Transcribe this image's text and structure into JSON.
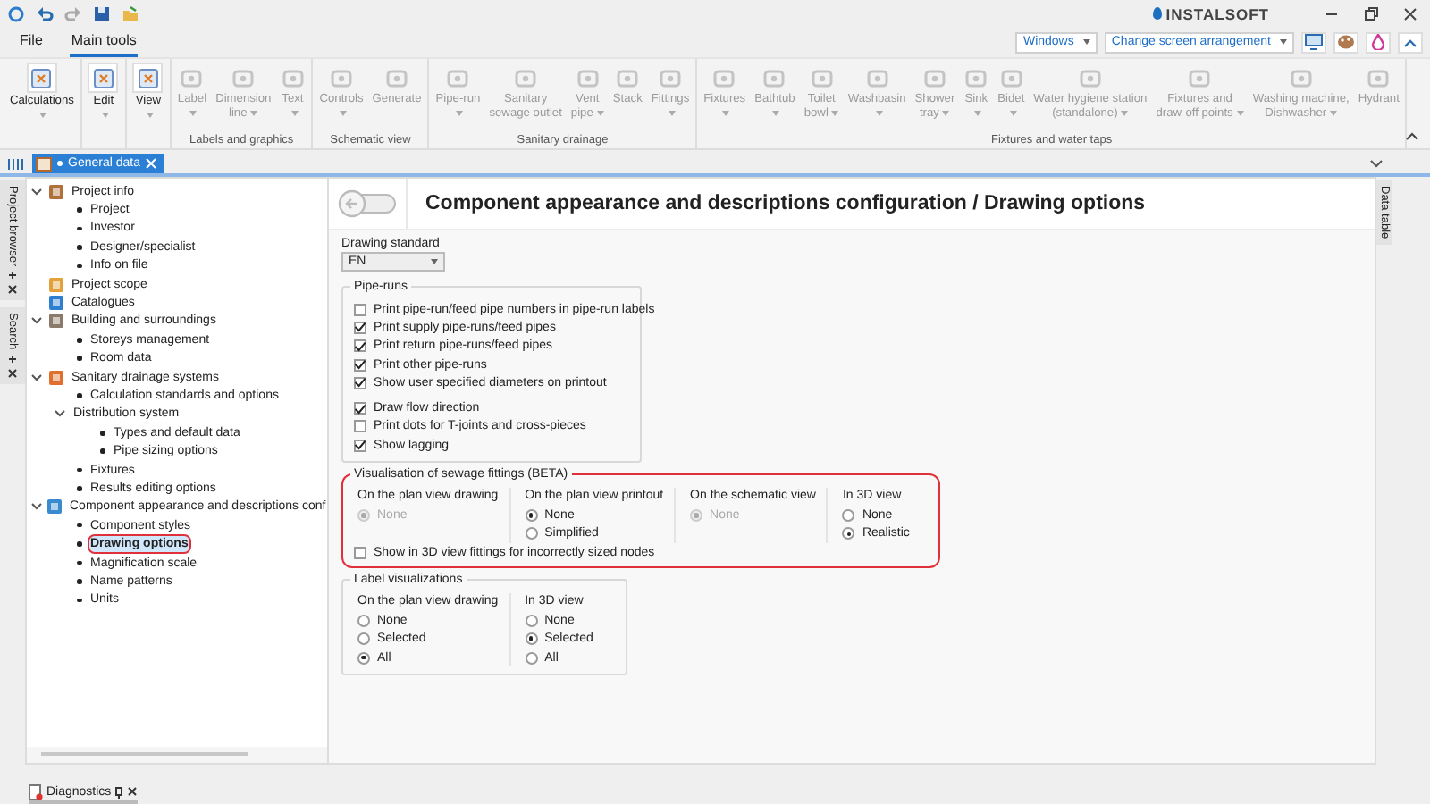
{
  "menu_tabs": [
    {
      "label": "File",
      "selected": false
    },
    {
      "label": "Main tools",
      "selected": true
    }
  ],
  "logo": {
    "text": "INSTALSOFT"
  },
  "window_dropdowns": [
    {
      "label": "Windows"
    },
    {
      "label": "Change screen arrangement"
    }
  ],
  "ribbon": {
    "groups": [
      {
        "items": [
          {
            "lines": [
              "Calculations"
            ],
            "disabled": false,
            "dropdown": true
          }
        ]
      },
      {
        "items": [
          {
            "lines": [
              "Edit"
            ],
            "disabled": false,
            "dropdown": true
          }
        ]
      },
      {
        "items": [
          {
            "lines": [
              "View"
            ],
            "disabled": false,
            "dropdown": true
          }
        ]
      },
      {
        "label": "Labels and graphics",
        "items": [
          {
            "lines": [
              "Label"
            ],
            "disabled": true,
            "dropdown": true
          },
          {
            "lines": [
              "Dimension",
              "line"
            ],
            "disabled": true,
            "dropdown": true
          },
          {
            "lines": [
              "Text"
            ],
            "disabled": true,
            "dropdown": true
          }
        ]
      },
      {
        "label": "Schematic view",
        "items": [
          {
            "lines": [
              "Controls"
            ],
            "disabled": true,
            "dropdown": true
          },
          {
            "lines": [
              "Generate"
            ],
            "disabled": true,
            "dropdown": false
          }
        ]
      },
      {
        "label": "Sanitary drainage",
        "items": [
          {
            "lines": [
              "Pipe-run"
            ],
            "disabled": true,
            "dropdown": true
          },
          {
            "lines": [
              "Sanitary",
              "sewage outlet"
            ],
            "disabled": true,
            "dropdown": false
          },
          {
            "lines": [
              "Vent",
              "pipe"
            ],
            "disabled": true,
            "dropdown": true
          },
          {
            "lines": [
              "Stack"
            ],
            "disabled": true,
            "dropdown": false
          },
          {
            "lines": [
              "Fittings"
            ],
            "disabled": true,
            "dropdown": true
          }
        ]
      },
      {
        "label": "Fixtures and water taps",
        "items": [
          {
            "lines": [
              "Fixtures"
            ],
            "disabled": true,
            "dropdown": true
          },
          {
            "lines": [
              "Bathtub"
            ],
            "disabled": true,
            "dropdown": true
          },
          {
            "lines": [
              "Toilet",
              "bowl"
            ],
            "disabled": true,
            "dropdown": true
          },
          {
            "lines": [
              "Washbasin"
            ],
            "disabled": true,
            "dropdown": true
          },
          {
            "lines": [
              "Shower",
              "tray"
            ],
            "disabled": true,
            "dropdown": true
          },
          {
            "lines": [
              "Sink"
            ],
            "disabled": true,
            "dropdown": true
          },
          {
            "lines": [
              "Bidet"
            ],
            "disabled": true,
            "dropdown": true
          },
          {
            "lines": [
              "Water hygiene station",
              "(standalone)"
            ],
            "disabled": true,
            "dropdown": true
          },
          {
            "lines": [
              "Fixtures and",
              "draw-off points"
            ],
            "disabled": true,
            "dropdown": true
          },
          {
            "lines": [
              "Washing machine,",
              "Dishwasher"
            ],
            "disabled": true,
            "dropdown": true
          },
          {
            "lines": [
              "Hydrant"
            ],
            "disabled": true,
            "dropdown": false
          }
        ]
      }
    ]
  },
  "document_tabs": [
    {
      "label": "General data",
      "selected": true
    }
  ],
  "side_panels": [
    {
      "label": "Project browser"
    },
    {
      "label": "Search"
    }
  ],
  "right_panels": [
    {
      "label": "Data table"
    }
  ],
  "tree": [
    {
      "label": "Project info",
      "expanded": true,
      "selected": false,
      "children": [
        {
          "label": "Project",
          "selected": false
        },
        {
          "label": "Investor",
          "selected": false
        },
        {
          "label": "Designer/specialist",
          "selected": false
        },
        {
          "label": "Info on file",
          "selected": false
        }
      ]
    },
    {
      "label": "Project scope",
      "selected": false
    },
    {
      "label": "Catalogues",
      "selected": false
    },
    {
      "label": "Building and surroundings",
      "expanded": true,
      "selected": false,
      "children": [
        {
          "label": "Storeys management",
          "selected": false
        },
        {
          "label": "Room data",
          "selected": false
        }
      ]
    },
    {
      "label": "Sanitary drainage systems",
      "expanded": true,
      "selected": false,
      "children": [
        {
          "label": "Calculation standards and options",
          "selected": false
        },
        {
          "label": "Distribution system",
          "expanded": true,
          "selected": false,
          "children": [
            {
              "label": "Types and default data",
              "selected": false
            },
            {
              "label": "Pipe sizing options",
              "selected": false
            }
          ]
        },
        {
          "label": "Fixtures",
          "selected": false
        },
        {
          "label": "Results editing options",
          "selected": false
        }
      ]
    },
    {
      "label": "Component appearance and descriptions conf",
      "expanded": true,
      "selected": false,
      "children": [
        {
          "label": "Component styles",
          "selected": false
        },
        {
          "label": "Drawing options",
          "selected": true,
          "highlighted": true
        },
        {
          "label": "Magnification scale",
          "selected": false
        },
        {
          "label": "Name patterns",
          "selected": false
        },
        {
          "label": "Units",
          "selected": false
        }
      ]
    }
  ],
  "content": {
    "title": "Component appearance and descriptions configuration / Drawing options",
    "drawing_standard": {
      "label": "Drawing standard",
      "value": "EN"
    },
    "pipe_runs": {
      "title": "Pipe-runs",
      "groups": [
        [
          {
            "label": "Print pipe-run/feed pipe numbers in pipe-run labels",
            "checked": false
          },
          {
            "label": "Print supply pipe-runs/feed pipes",
            "checked": true
          },
          {
            "label": "Print return pipe-runs/feed pipes",
            "checked": true
          },
          {
            "label": "Print other pipe-runs",
            "checked": true
          },
          {
            "label": "Show user specified diameters on printout",
            "checked": true
          }
        ],
        [
          {
            "label": "Draw flow direction",
            "checked": true
          },
          {
            "label": "Print dots for T-joints and cross-pieces",
            "checked": false
          },
          {
            "label": "Show lagging",
            "checked": true
          }
        ]
      ]
    },
    "visualisation": {
      "title": "Visualisation of sewage fittings (BETA)",
      "highlighted": true,
      "columns": [
        {
          "heading": "On the plan view drawing",
          "options": [
            {
              "label": "None",
              "selected": true,
              "disabled": true
            }
          ]
        },
        {
          "heading": "On the plan view printout",
          "options": [
            {
              "label": "None",
              "selected": true,
              "disabled": false
            },
            {
              "label": "Simplified",
              "selected": false,
              "disabled": false
            }
          ]
        },
        {
          "heading": "On the schematic view",
          "options": [
            {
              "label": "None",
              "selected": true,
              "disabled": true
            }
          ]
        },
        {
          "heading": "In 3D view",
          "options": [
            {
              "label": "None",
              "selected": false,
              "disabled": false
            },
            {
              "label": "Realistic",
              "selected": true,
              "disabled": false
            }
          ]
        }
      ],
      "checkbox": {
        "label": "Show in 3D view fittings for incorrectly sized nodes",
        "checked": false
      }
    },
    "label_visualizations": {
      "title": "Label visualizations",
      "columns": [
        {
          "heading": "On the plan view drawing",
          "options": [
            {
              "label": "None",
              "selected": false,
              "disabled": false
            },
            {
              "label": "Selected",
              "selected": false,
              "disabled": false
            },
            {
              "label": "All",
              "selected": true,
              "disabled": false
            }
          ]
        },
        {
          "heading": "In 3D view",
          "options": [
            {
              "label": "None",
              "selected": false,
              "disabled": false
            },
            {
              "label": "Selected",
              "selected": true,
              "disabled": false
            },
            {
              "label": "All",
              "selected": false,
              "disabled": false
            }
          ]
        }
      ]
    }
  },
  "bottom_tabs": [
    {
      "label": "Diagnostics"
    }
  ]
}
